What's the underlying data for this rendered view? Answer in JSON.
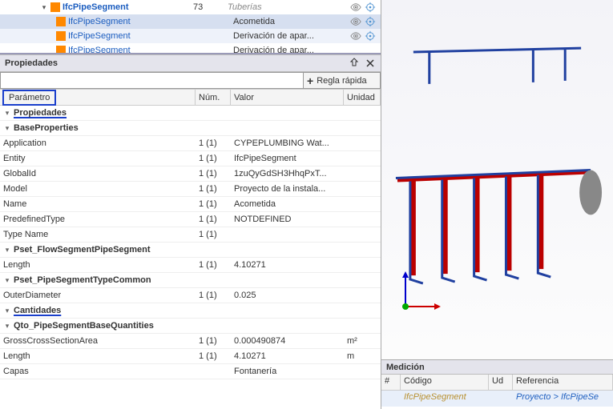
{
  "tree": {
    "rows": [
      {
        "label": "IfcPipeSegment",
        "num": "73",
        "desc": "Tuberías",
        "descStyle": "gray",
        "bold": true,
        "selected": false,
        "expander": "▾"
      },
      {
        "label": "IfcPipeSegment",
        "num": "",
        "desc": "Acometida",
        "descStyle": "normal",
        "bold": false,
        "selected": true,
        "expander": ""
      },
      {
        "label": "IfcPipeSegment",
        "num": "",
        "desc": "Derivación de apar...",
        "descStyle": "normal",
        "bold": false,
        "selected": false,
        "expander": ""
      },
      {
        "label": "IfcPipeSegment",
        "num": "",
        "desc": "Derivación de apar...",
        "descStyle": "normal",
        "bold": false,
        "selected": false,
        "expander": ""
      }
    ]
  },
  "panel": {
    "title": "Propiedades"
  },
  "filter": {
    "placeholder": "",
    "button": "Regla rápida"
  },
  "columns": {
    "param": "Parámetro",
    "num": "Núm.",
    "val": "Valor",
    "unit": "Unidad"
  },
  "groups": {
    "propiedades": "Propiedades",
    "baseProperties": "BaseProperties",
    "psetFlow": "Pset_FlowSegmentPipeSegment",
    "psetType": "Pset_PipeSegmentTypeCommon",
    "cantidades": "Cantidades",
    "qtoBase": "Qto_PipeSegmentBaseQuantities",
    "capas": "Capas"
  },
  "props": {
    "application": {
      "label": "Application",
      "num": "1 (1)",
      "val": "CYPEPLUMBING Wat..."
    },
    "entity": {
      "label": "Entity",
      "num": "1 (1)",
      "val": "IfcPipeSegment"
    },
    "globalId": {
      "label": "GlobalId",
      "num": "1 (1)",
      "val": "1zuQyGdSH3HhqPxT..."
    },
    "model": {
      "label": "Model",
      "num": "1 (1)",
      "val": "Proyecto de la instala..."
    },
    "name": {
      "label": "Name",
      "num": "1 (1)",
      "val": "Acometida"
    },
    "predefType": {
      "label": "PredefinedType",
      "num": "1 (1)",
      "val": "NOTDEFINED"
    },
    "typeName": {
      "label": "Type Name",
      "num": "1 (1)",
      "val": ""
    },
    "length": {
      "label": "Length",
      "num": "1 (1)",
      "val": "4.10271"
    },
    "outerDia": {
      "label": "OuterDiameter",
      "num": "1 (1)",
      "val": "0.025"
    },
    "gcsa": {
      "label": "GrossCrossSectionArea",
      "num": "1 (1)",
      "val": "0.000490874",
      "unit": "m²"
    },
    "qtoLength": {
      "label": "Length",
      "num": "1 (1)",
      "val": "4.10271",
      "unit": "m"
    },
    "fontaneria": {
      "val": "Fontanería"
    }
  },
  "medicion": {
    "title": "Medición",
    "cols": {
      "hash": "#",
      "code": "Código",
      "ud": "Ud",
      "ref": "Referencia"
    },
    "row": {
      "code": "IfcPipeSegment",
      "ref": "Proyecto > IfcPipeSe"
    }
  }
}
